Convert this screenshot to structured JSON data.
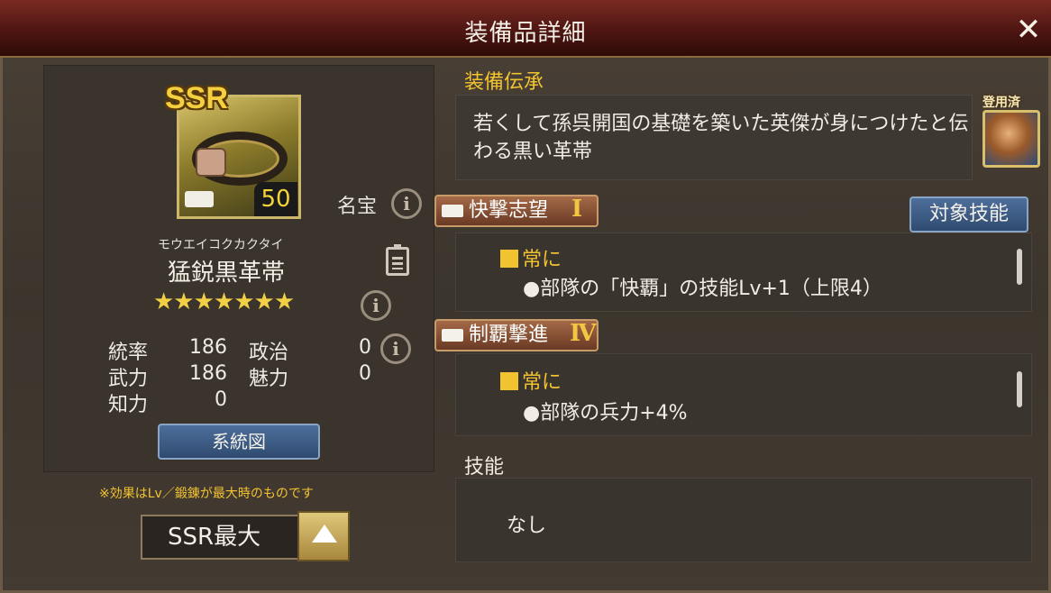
{
  "window": {
    "title": "装備品詳細",
    "close_label": "✕"
  },
  "item": {
    "rarity": "SSR",
    "level": "50",
    "category": "名宝",
    "reading": "モウエイコクカクタイ",
    "name": "猛鋭黒革帯",
    "stars": "★★★★★★★"
  },
  "stats": [
    {
      "label": "統率",
      "value": "186"
    },
    {
      "label": "政治",
      "value": "0"
    },
    {
      "label": "武力",
      "value": "186"
    },
    {
      "label": "魅力",
      "value": "0"
    },
    {
      "label": "知力",
      "value": "0"
    }
  ],
  "buttons": {
    "lineage": "系統図",
    "target_skill": "対象技能"
  },
  "note": "※効果はLv／鍛錬が最大時のものです",
  "level_select": {
    "value": "SSR最大"
  },
  "lore": {
    "heading": "装備伝承",
    "text": "若くして孫呉開国の基礎を築いた英傑が身につけたと伝わる黒い革帯",
    "used_label": "登用済"
  },
  "skills": [
    {
      "name": "快撃志望",
      "rank": "Ⅰ",
      "trigger": "常に",
      "effect": "●部隊の「快覇」の技能Lv+1（上限4）"
    },
    {
      "name": "制覇撃進",
      "rank": "Ⅳ",
      "trigger": "常に",
      "effect": "●部隊の兵力+4%"
    }
  ],
  "skill_section": {
    "heading": "技能",
    "value": "なし"
  },
  "icons": [
    "close-icon",
    "info-icon",
    "clipboard-icon",
    "scroll-icon",
    "up-arrow-icon",
    "general-portrait"
  ],
  "colors": {
    "accent_gold": "#f1c330",
    "title_red": "#5a1a14",
    "button_blue": "#3e5d86"
  }
}
